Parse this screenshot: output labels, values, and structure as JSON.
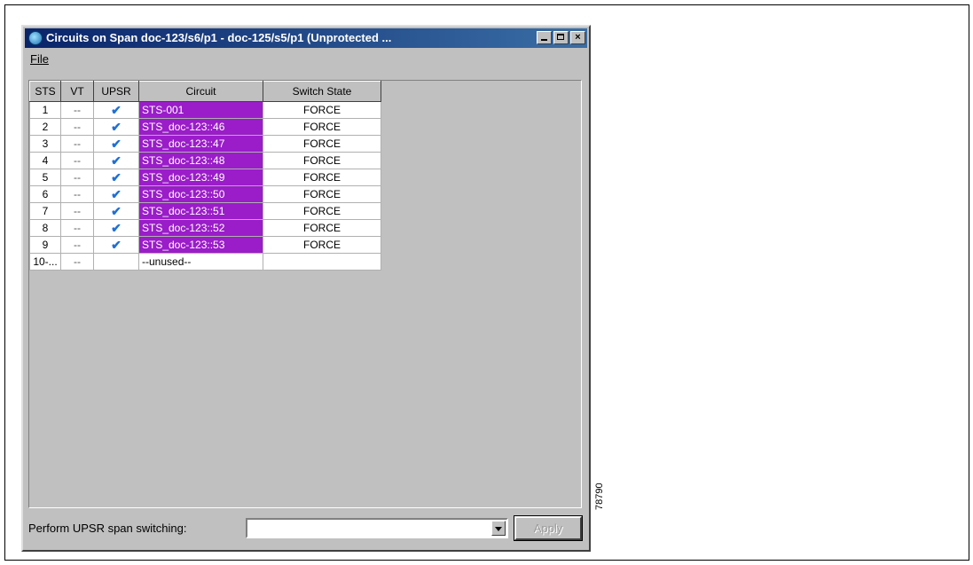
{
  "window": {
    "title": "Circuits on Span doc-123/s6/p1 - doc-125/s5/p1 (Unprotected ...",
    "buttons": {
      "minimize": "",
      "maximize": "",
      "close": "×"
    }
  },
  "menu": {
    "file": "File"
  },
  "table": {
    "headers": [
      "STS",
      "VT",
      "UPSR",
      "Circuit",
      "Switch State"
    ],
    "rows": [
      {
        "sts": "1",
        "vt": "--",
        "upsr": "✔",
        "circuit": "STS-001",
        "switch": "FORCE",
        "highlight": true
      },
      {
        "sts": "2",
        "vt": "--",
        "upsr": "✔",
        "circuit": "STS_doc-123::46",
        "switch": "FORCE",
        "highlight": true
      },
      {
        "sts": "3",
        "vt": "--",
        "upsr": "✔",
        "circuit": "STS_doc-123::47",
        "switch": "FORCE",
        "highlight": true
      },
      {
        "sts": "4",
        "vt": "--",
        "upsr": "✔",
        "circuit": "STS_doc-123::48",
        "switch": "FORCE",
        "highlight": true
      },
      {
        "sts": "5",
        "vt": "--",
        "upsr": "✔",
        "circuit": "STS_doc-123::49",
        "switch": "FORCE",
        "highlight": true
      },
      {
        "sts": "6",
        "vt": "--",
        "upsr": "✔",
        "circuit": "STS_doc-123::50",
        "switch": "FORCE",
        "highlight": true
      },
      {
        "sts": "7",
        "vt": "--",
        "upsr": "✔",
        "circuit": "STS_doc-123::51",
        "switch": "FORCE",
        "highlight": true
      },
      {
        "sts": "8",
        "vt": "--",
        "upsr": "✔",
        "circuit": "STS_doc-123::52",
        "switch": "FORCE",
        "highlight": true
      },
      {
        "sts": "9",
        "vt": "--",
        "upsr": "✔",
        "circuit": "STS_doc-123::53",
        "switch": "FORCE",
        "highlight": true
      },
      {
        "sts": "10-...",
        "vt": "--",
        "upsr": "",
        "circuit": "--unused--",
        "switch": "",
        "highlight": false
      }
    ]
  },
  "bottom": {
    "label": "Perform UPSR span switching:",
    "select_value": "",
    "apply_label": "Apply"
  },
  "figure_id": "78790",
  "colors": {
    "highlight": "#9a1dc9",
    "check": "#1f6fd6",
    "titlebar": "#0a246a"
  }
}
